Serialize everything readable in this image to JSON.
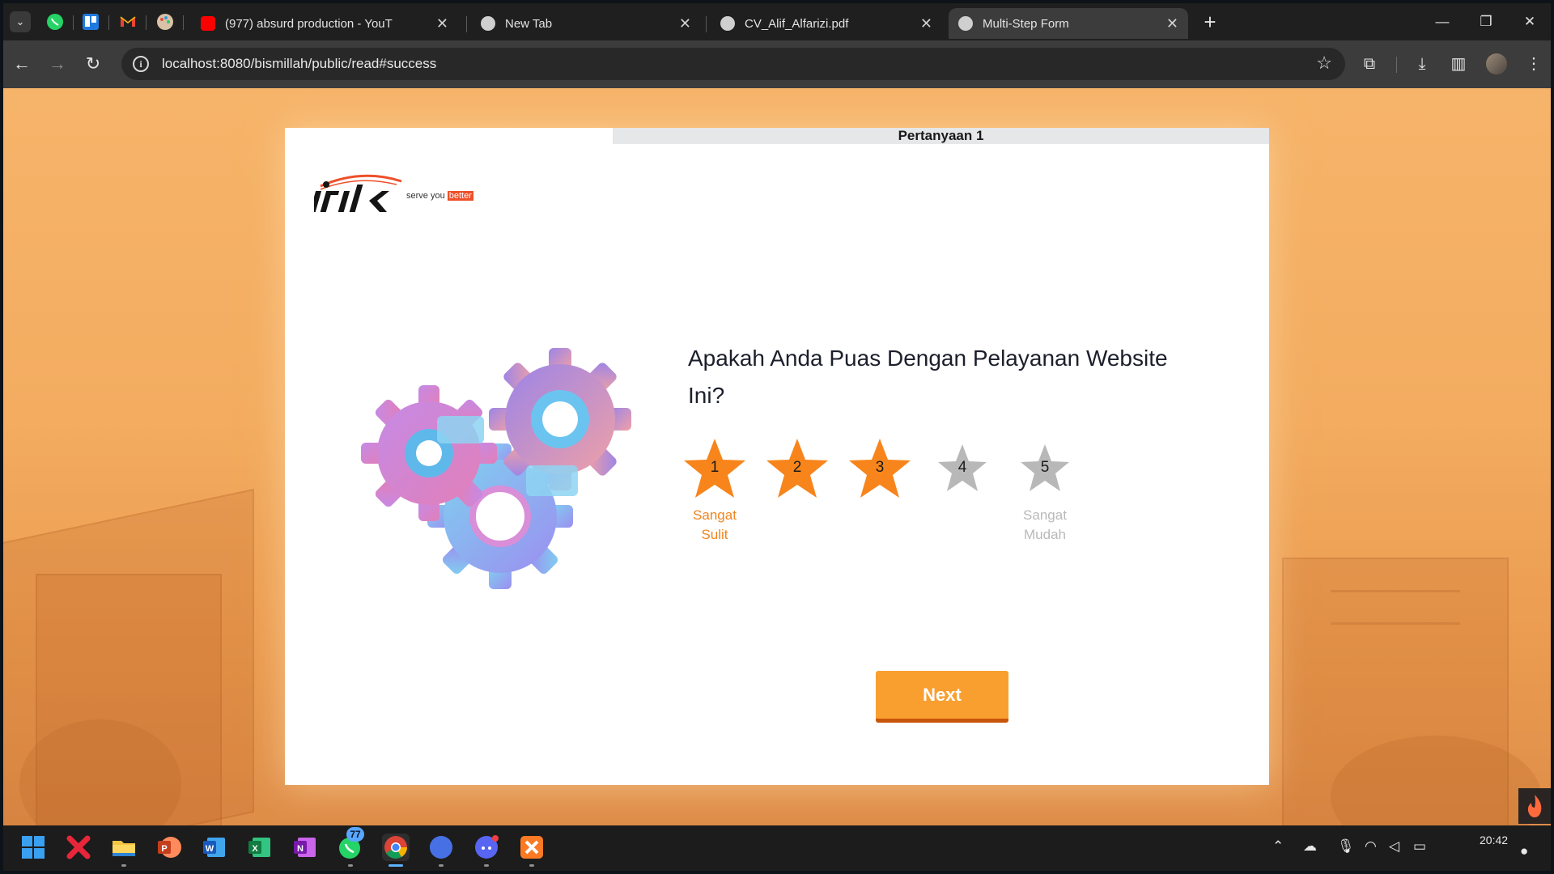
{
  "browser": {
    "tabs": [
      {
        "title": "(977) absurd production - YouT",
        "favicon": "youtube-icon"
      },
      {
        "title": "New Tab",
        "favicon": "chrome-icon"
      },
      {
        "title": "CV_Alif_Alfarizi.pdf",
        "favicon": "globe-icon"
      },
      {
        "title": "Multi-Step Form",
        "favicon": "globe-icon",
        "active": true
      }
    ],
    "pinned_tabs": [
      "whatsapp-icon",
      "trello-icon",
      "gmail-icon",
      "palette-icon"
    ],
    "url": "localhost:8080/bismillah/public/read#success"
  },
  "form": {
    "step_label": "Pertanyaan 1",
    "logo_tagline_prefix": "serve you",
    "logo_tagline_highlight": "better",
    "question": "Apakah Anda Puas Dengan Pelayanan Website Ini?",
    "rating": {
      "selected": 3,
      "options": [
        {
          "value": "1",
          "caption_line1": "Sangat",
          "caption_line2": "Sulit"
        },
        {
          "value": "2",
          "caption_line1": "",
          "caption_line2": ""
        },
        {
          "value": "3",
          "caption_line1": "",
          "caption_line2": ""
        },
        {
          "value": "4",
          "caption_line1": "",
          "caption_line2": ""
        },
        {
          "value": "5",
          "caption_line1": "Sangat",
          "caption_line2": "Mudah"
        }
      ]
    },
    "next_label": "Next"
  },
  "taskbar": {
    "apps": [
      "windows-start-icon",
      "xmind-icon",
      "file-explorer-icon",
      "powerpoint-icon",
      "word-icon",
      "excel-icon",
      "onenote-icon",
      "whatsapp-icon",
      "chrome-icon",
      "canva-icon",
      "discord-icon",
      "xampp-icon"
    ],
    "whatsapp_badge": "77",
    "clock": "20:42"
  },
  "colors": {
    "accent_orange": "#f99f30",
    "star_active": "#f7851c",
    "star_inactive": "#b8b8b8",
    "caption_orange": "#f08420"
  }
}
